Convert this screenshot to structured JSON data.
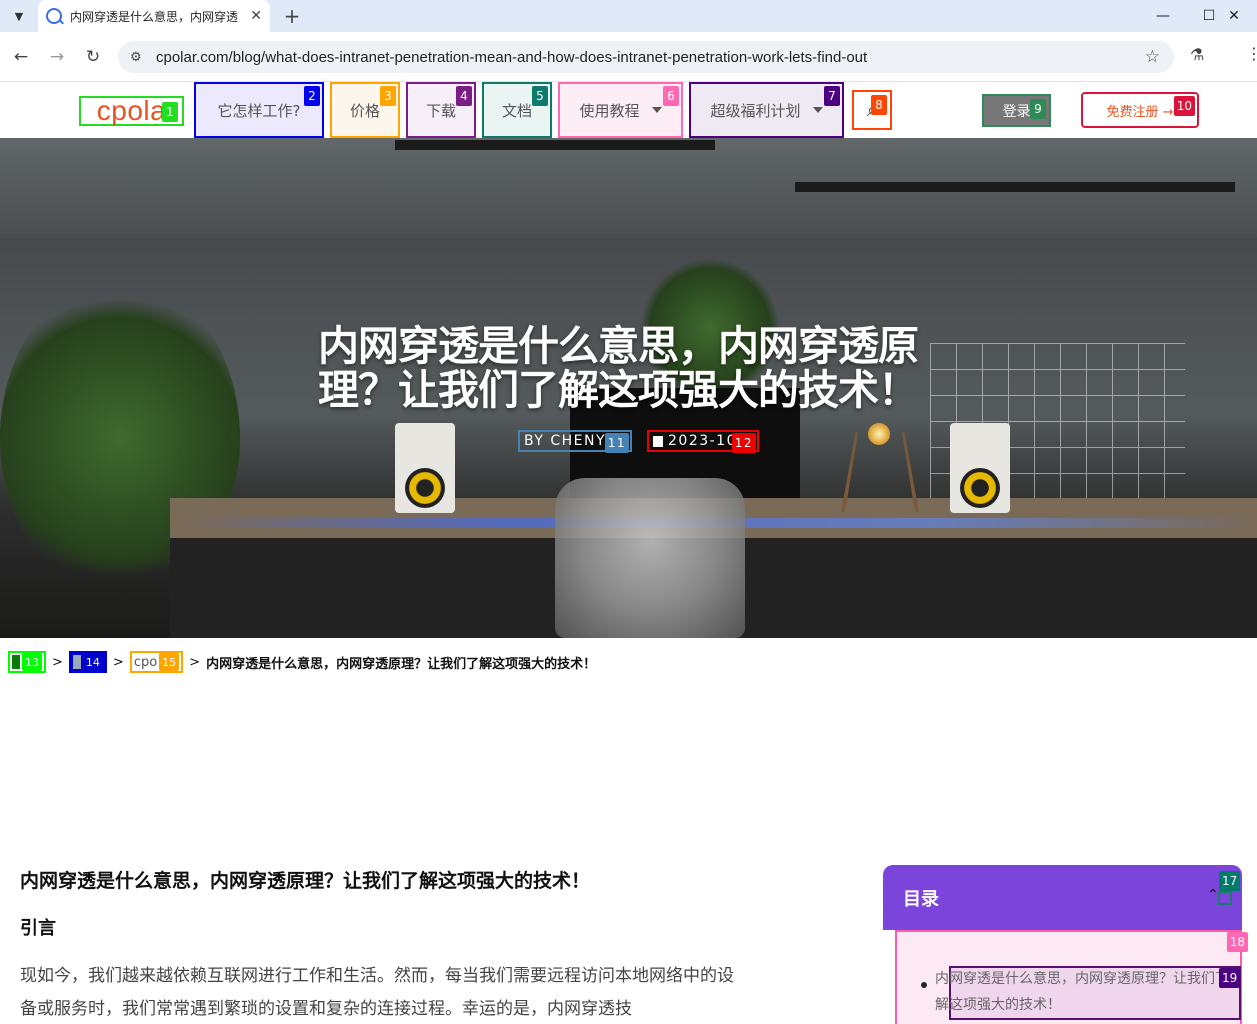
{
  "browser": {
    "tab_title": "内网穿透是什么意思，内网穿透",
    "url": "cpolar.com/blog/what-does-intranet-penetration-mean-and-how-does-intranet-penetration-work-lets-find-out",
    "new_tab_symbol": "+",
    "close_symbol": "✕"
  },
  "nav": {
    "logo": "cpola",
    "how_it_works": "它怎样工作?",
    "pricing": "价格",
    "download": "下载",
    "docs": "文档",
    "tutorials": "使用教程",
    "benefits": "超级福利计划",
    "login": "登录",
    "register": "免费注册 →"
  },
  "badges": {
    "b1": "1",
    "b2": "2",
    "b3": "3",
    "b4": "4",
    "b5": "5",
    "b6": "6",
    "b7": "7",
    "b8": "8",
    "b9": "9",
    "b10": "10",
    "b11": "11",
    "b12": "12",
    "b13": "13",
    "b14": "14",
    "b15": "15",
    "b17": "17",
    "b18": "18",
    "b19": "19"
  },
  "hero": {
    "title": "内网穿透是什么意思，内网穿透原理？让我们了解这项强大的技术！",
    "author": "BY CHENYU",
    "date": "2023-10-"
  },
  "breadcrumb": {
    "sep": ">",
    "crumb3": "cpo",
    "current": "内网穿透是什么意思，内网穿透原理？让我们了解这项强大的技术！"
  },
  "article": {
    "h1": "内网穿透是什么意思，内网穿透原理？让我们了解这项强大的技术！",
    "h2": "引言",
    "p": "现如今，我们越来越依赖互联网进行工作和生活。然而，每当我们需要远程访问本地网络中的设备或服务时，我们常常遇到繁琐的设置和复杂的连接过程。幸运的是，内网穿透技"
  },
  "toc": {
    "title": "目录",
    "item1": "内网穿透是什么意思，内网穿透原理？让我们了解这项强大的技术！"
  },
  "colors": {
    "b1": "#22dd22",
    "b2": "#0000ee",
    "b3": "#ffa500",
    "b4": "#7b1d86",
    "b5": "#0d7a6c",
    "b6": "#ff69b4",
    "b7": "#4b0082",
    "b8": "#ff4500",
    "b9": "#2e8b57",
    "b10": "#dc143c",
    "b11": "#4682b4",
    "b12": "#ee0000",
    "b13": "#00ff00",
    "b14": "#0000cd",
    "b15": "#ffa500",
    "b17": "#007a6a",
    "b18": "#ff69b4",
    "b19": "#4b0082",
    "toc_header": "#7b45dc",
    "logo": "#e8521f"
  }
}
